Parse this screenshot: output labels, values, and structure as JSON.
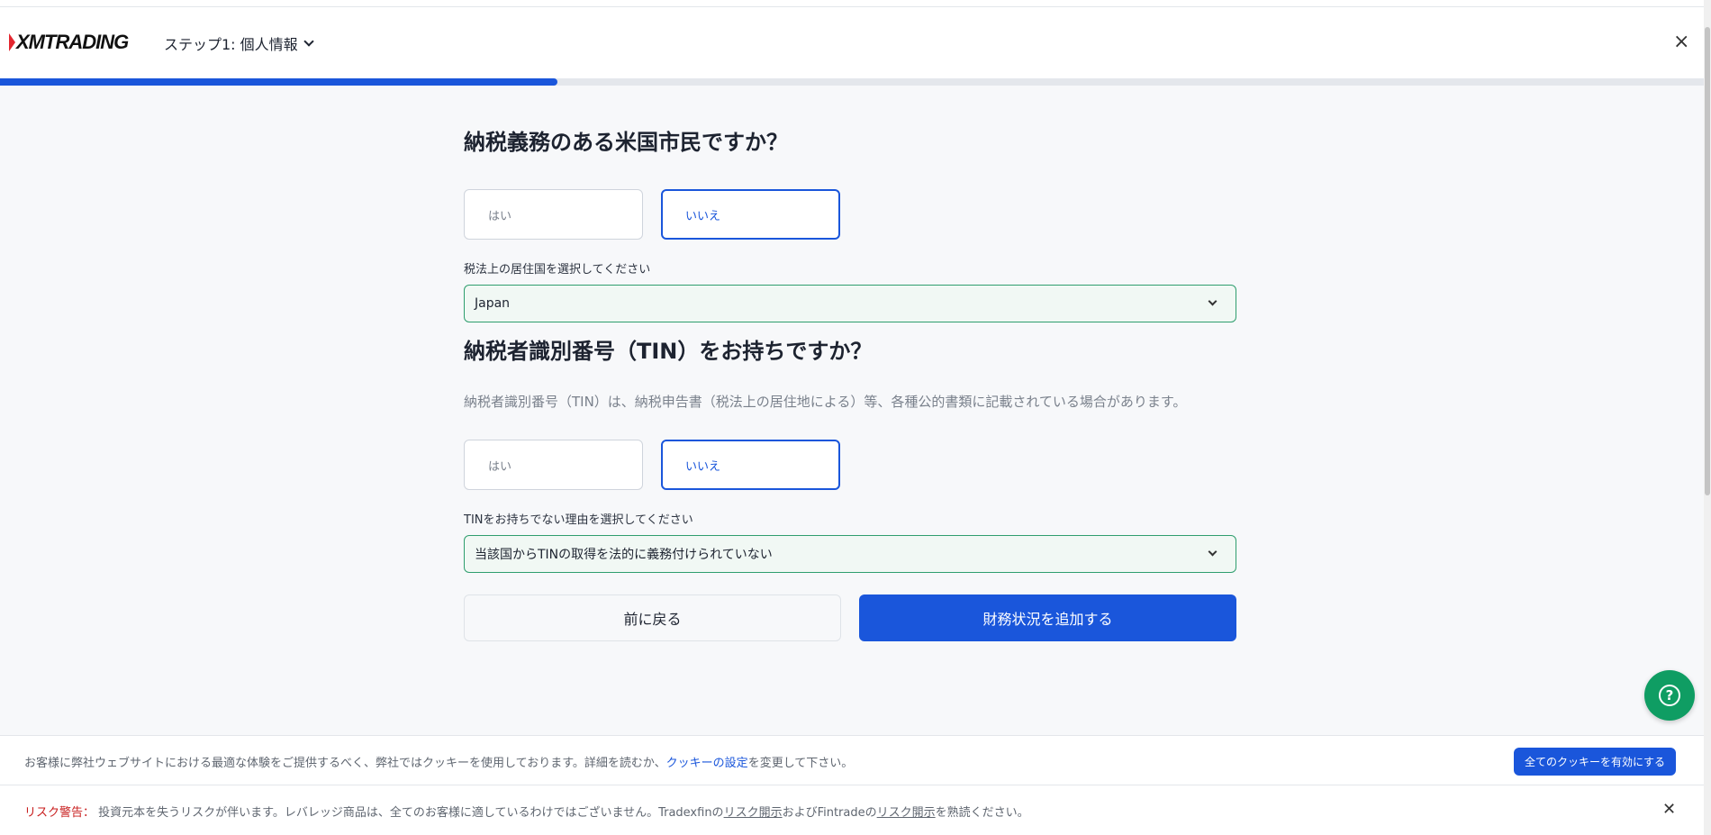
{
  "header": {
    "logo_text": "XMTRADING",
    "step_label": "ステップ1: 個人情報",
    "close_symbol": "×"
  },
  "progress": {
    "fraction": 0.327,
    "color": "#1a56db"
  },
  "form": {
    "q1": {
      "title": "納税義務のある米国市民ですか？",
      "yes": "はい",
      "no": "いいえ",
      "selected": "no"
    },
    "residence": {
      "label": "税法上の居住国を選択してください",
      "value": "Japan"
    },
    "q2": {
      "title": "納税者識別番号（TIN）をお持ちですか？",
      "description": "納税者識別番号（TIN）は、納税申告書（税法上の居住地による）等、各種公的書類に記載されている場合があります。",
      "yes": "はい",
      "no": "いいえ",
      "selected": "no"
    },
    "tin_reason": {
      "label": "TINをお持ちでない理由を選択してください",
      "value": "当該国からTINの取得を法的に義務付けられていない"
    },
    "back_button": "前に戻る",
    "next_button": "財務状況を追加する"
  },
  "help": {
    "icon": "help-icon",
    "symbol": "?"
  },
  "cookie": {
    "text_before": "お客様に弊社ウェブサイトにおける最適な体験をご提供するべく、弊社ではクッキーを使用しております。詳細を読むか、",
    "link": "クッキーの設定",
    "text_after": "を変更して下さい。",
    "accept_button": "全てのクッキーを有効にする"
  },
  "risk": {
    "label": "リスク警告：",
    "text1": " 投資元本を失うリスクが伴います。レバレッジ商品は、全てのお客様に適しているわけではございません。Tradexfinの",
    "link1": "リスク開示",
    "text2": "およびFintradeの",
    "link2": "リスク開示",
    "text3": "を熟読ください。",
    "close_symbol": "✕"
  },
  "colors": {
    "primary": "#1a56db",
    "success": "#0f9d63",
    "warning": "#c81e1e"
  }
}
